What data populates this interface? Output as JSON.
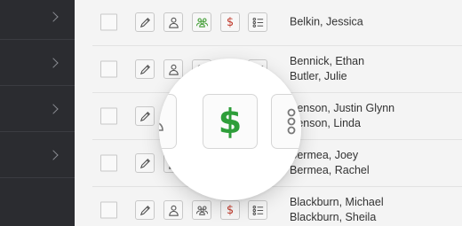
{
  "colors": {
    "sidebar_bg": "#2b2c30",
    "content_bg": "#f4f4f4",
    "donation_icon_red": "#c0392b",
    "donation_icon_green": "#2e9e3a",
    "household_icon_green": "#3c9a2f",
    "icon_gray": "#555555"
  },
  "sidebar": {
    "items": [
      {
        "icon": "chevron-right-icon"
      },
      {
        "icon": "chevron-right-icon"
      },
      {
        "icon": "chevron-right-icon"
      },
      {
        "icon": "chevron-right-icon"
      }
    ]
  },
  "rows": [
    {
      "names": [
        "Belkin, Jessica"
      ],
      "household_active": true
    },
    {
      "names": [
        "Bennick, Ethan",
        "Butler, Julie"
      ],
      "household_active": false
    },
    {
      "names": [
        "Benson, Justin Glynn",
        "Benson, Linda"
      ],
      "household_active": false
    },
    {
      "names": [
        "Bermea, Joey",
        "Bermea, Rachel"
      ],
      "household_active": false
    },
    {
      "names": [
        "Blackburn, Michael",
        "Blackburn, Sheila"
      ],
      "household_active": false
    }
  ],
  "row_actions": [
    "edit-icon",
    "person-icon",
    "household-icon",
    "dollar-icon",
    "list-icon"
  ],
  "dollar_symbol": "$",
  "magnifier": {
    "focused_button": "donation-button",
    "dollar_symbol": "$"
  }
}
